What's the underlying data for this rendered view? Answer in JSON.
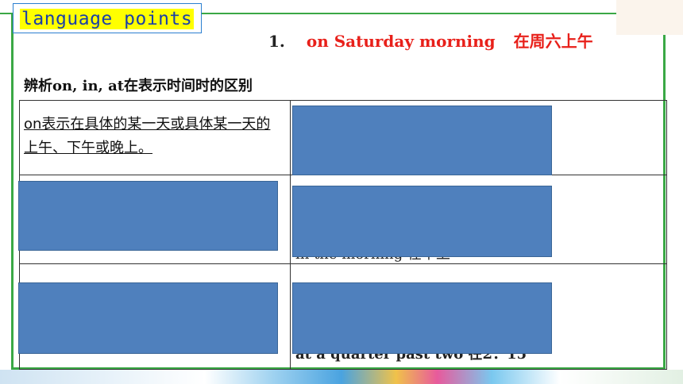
{
  "header": {
    "badge_label": "language points",
    "item_number": "1.",
    "phrase_en": "on Saturday morning",
    "phrase_cn": "在周六上午"
  },
  "section": {
    "subtitle": "辨析on, in, at在表示时间时的区别"
  },
  "table": {
    "row1_left": "on表示在具体的某一天或具体某一天的上午、下午或晚上。",
    "row2_peek": "in the morning 在早上",
    "row3_peek": "at a quarter past two 在2：15"
  },
  "colors": {
    "frame_green": "#3aa845",
    "accent_red": "#e8201a",
    "badge_yellow": "#ffff00",
    "cover_blue": "#4f80bd"
  }
}
